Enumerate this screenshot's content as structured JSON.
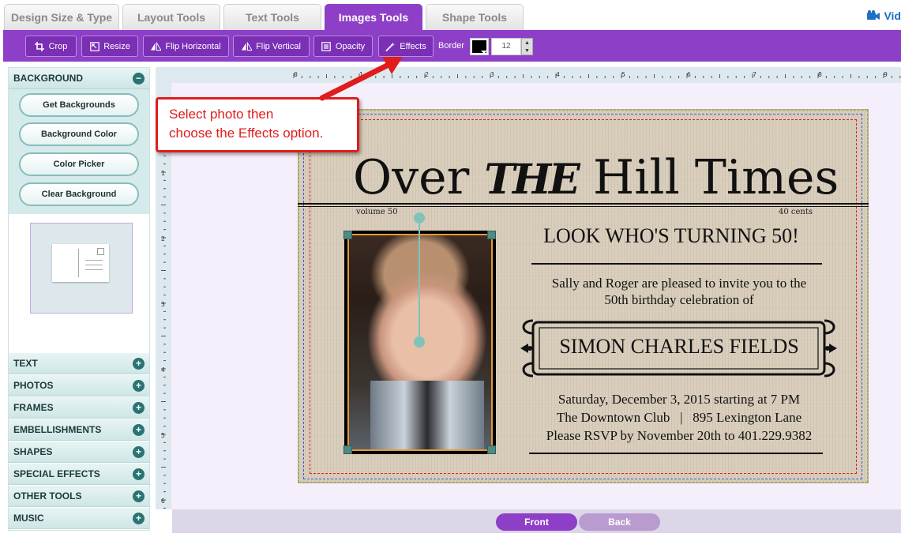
{
  "tabs": [
    {
      "label": "Design Size & Type",
      "active": false
    },
    {
      "label": "Layout Tools",
      "active": false
    },
    {
      "label": "Text Tools",
      "active": false
    },
    {
      "label": "Images Tools",
      "active": true
    },
    {
      "label": "Shape Tools",
      "active": false
    }
  ],
  "video_link": "Vid",
  "toolbar": {
    "crop": "Crop",
    "resize": "Resize",
    "flip_h": "Flip Horizontal",
    "flip_v": "Flip Vertical",
    "opacity": "Opacity",
    "effects": "Effects",
    "border_label": "Border",
    "border_color": "#000000",
    "border_width": "12"
  },
  "sidebar": {
    "background": {
      "title": "BACKGROUND",
      "toggle": "−",
      "buttons": [
        "Get  Backgrounds",
        "Background Color",
        "Color Picker",
        "Clear Background"
      ]
    },
    "sections": [
      {
        "label": "TEXT",
        "toggle": "+"
      },
      {
        "label": "PHOTOS",
        "toggle": "+"
      },
      {
        "label": "FRAMES",
        "toggle": "+"
      },
      {
        "label": "EMBELLISHMENTS",
        "toggle": "+"
      },
      {
        "label": "SHAPES",
        "toggle": "+"
      },
      {
        "label": "SPECIAL EFFECTS",
        "toggle": "+"
      },
      {
        "label": "OTHER TOOLS",
        "toggle": "+"
      },
      {
        "label": "MUSIC",
        "toggle": "+"
      }
    ]
  },
  "ruler": {
    "top_numbers": [
      "0",
      "1",
      "2",
      "3",
      "4",
      "5",
      "6",
      "7",
      "8",
      "9"
    ],
    "left_numbers": [
      "1",
      "2",
      "3",
      "4",
      "5",
      "6"
    ]
  },
  "callout": {
    "line1": "Select photo then",
    "line2": "choose the Effects option."
  },
  "card": {
    "masthead_over": "Over",
    "masthead_the": "THE",
    "masthead_hill": "Hill Times",
    "volume": "volume 50",
    "price": "40 cents",
    "headline": "LOOK WHO'S TURNING 50!",
    "invite_line1": "Sally and Roger are pleased to invite you to the",
    "invite_line2": "50th birthday celebration of",
    "name": "SIMON CHARLES FIELDS",
    "detail_line1": "Saturday, December 3, 2015 starting at 7 PM",
    "detail_line2": "The Downtown Club   |   895 Lexington Lane",
    "detail_line3": "Please RSVP by November 20th to 401.229.9382"
  },
  "nav": {
    "front": "Front",
    "back": "Back"
  },
  "colors": {
    "accent": "#8e3fc7",
    "callout": "#e01c1c",
    "card_bg": "#d8ccba"
  }
}
